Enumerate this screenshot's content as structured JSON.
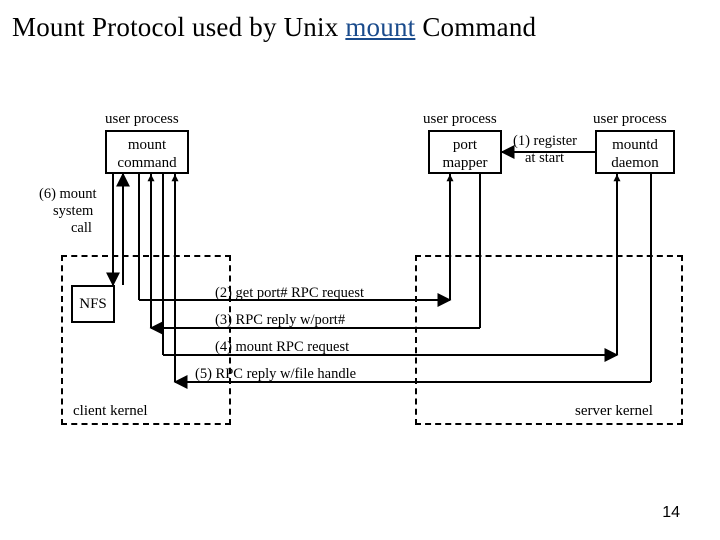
{
  "title": {
    "pre": "Mount Protocol used by Unix ",
    "link": "mount",
    "post": " Command"
  },
  "labels": {
    "user_process_left": "user process",
    "user_process_mid": "user process",
    "user_process_right": "user process",
    "client_kernel": "client kernel",
    "server_kernel": "server kernel"
  },
  "boxes": {
    "mount_cmd_l1": "mount",
    "mount_cmd_l2": "command",
    "nfs": "NFS",
    "port_mapper_l1": "port",
    "port_mapper_l2": "mapper",
    "mountd_l1": "mountd",
    "mountd_l2": "daemon"
  },
  "arrows": {
    "a1": "(1) register",
    "a1b": "at start",
    "a2": "(2) get port# RPC request",
    "a3": "(3) RPC reply w/port#",
    "a4": "(4) mount RPC request",
    "a5": "(5) RPC reply w/file handle",
    "a6_l1": "(6) mount",
    "a6_l2": "system",
    "a6_l3": "call"
  },
  "page_number": "14"
}
